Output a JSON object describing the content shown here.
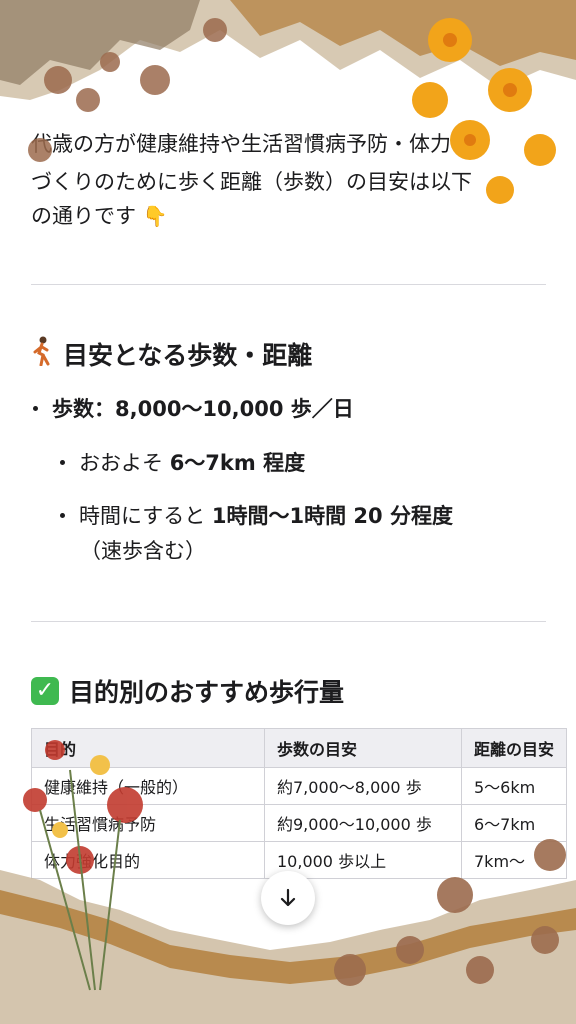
{
  "intro": {
    "line1": "代歳の方が健康維持や生活習慣病予防・体力",
    "line2": "づくりのために歩く距離（歩数）の目安は以下",
    "line3": "の通りです",
    "emoji": "👇"
  },
  "section1": {
    "icon": "walking-person-icon",
    "title": "目安となる歩数・距離",
    "steps_prefix": "歩数：",
    "steps_value": "8,000〜10,000 歩／日",
    "distance_prefix": "おおよそ ",
    "distance_value": "6〜7km 程度",
    "time_prefix": "時間にすると ",
    "time_value": "1時間〜1時間 20 分程度",
    "time_note": "（速歩含む）"
  },
  "section2": {
    "icon": "check-mark-icon",
    "title": "目的別のおすすめ歩行量",
    "table": {
      "headers": [
        "目的",
        "歩数の目安",
        "距離の目安"
      ],
      "rows": [
        [
          "健康維持（一般的）",
          "約7,000〜8,000 歩",
          "5〜6km"
        ],
        [
          "生活習慣病予防",
          "約9,000〜10,000 歩",
          "6〜7km"
        ],
        [
          "体力強化目的",
          "10,000 歩以上",
          "7km〜"
        ]
      ]
    }
  },
  "scroll_button": {
    "icon": "arrow-down-icon"
  }
}
